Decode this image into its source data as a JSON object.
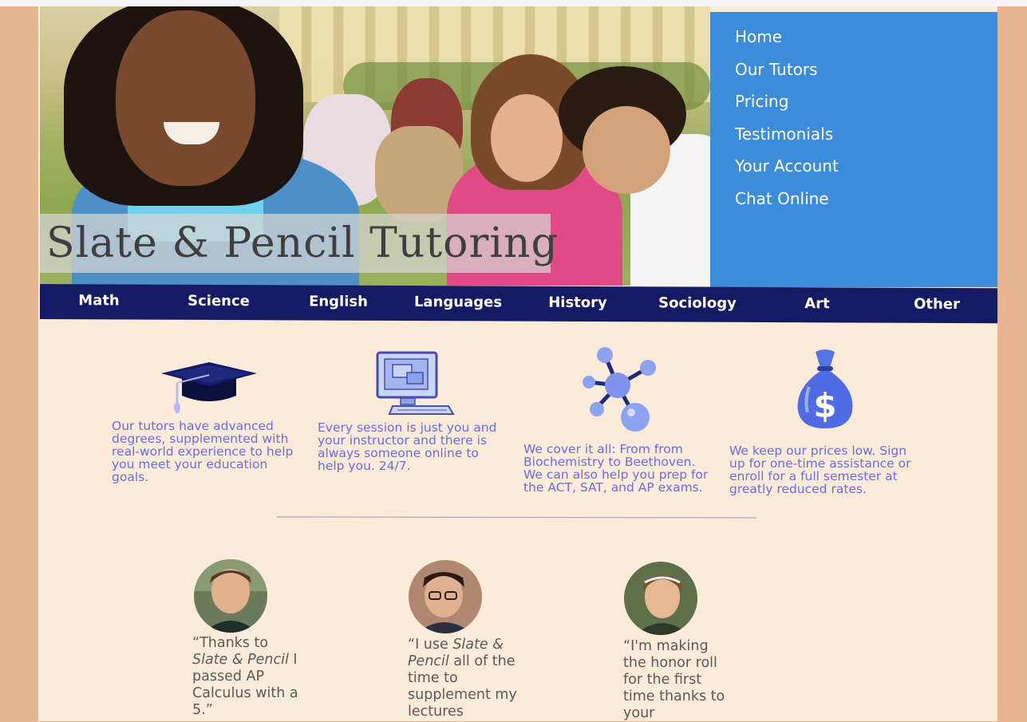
{
  "site": {
    "title": "Slate & Pencil Tutoring"
  },
  "nav": {
    "items": [
      "Home",
      "Our Tutors",
      "Pricing",
      "Testimonials",
      "Your Account",
      "Chat Online"
    ]
  },
  "subjects": {
    "items": [
      "Math",
      "Science",
      "English",
      "Languages",
      "History",
      "Sociology",
      "Art",
      "Other"
    ]
  },
  "features": [
    {
      "icon": "graduation-cap-icon",
      "text": "Our tutors have advanced degrees, supplemented with real-world experience to help you meet your education goals."
    },
    {
      "icon": "computer-icon",
      "text": "Every session is just you and your instructor and there is always someone online to help you. 24/7."
    },
    {
      "icon": "molecule-icon",
      "text": "We cover it all: From from Biochemistry to Beethoven. We can also help you prep for the ACT, SAT, and AP exams."
    },
    {
      "icon": "money-bag-icon",
      "text": "We keep our prices low. Sign up for one-time assistance or enroll for a full semester at greatly reduced rates."
    }
  ],
  "testimonials": [
    {
      "open": "“Thanks to ",
      "em": "Slate & Pencil",
      "close": " I passed AP Calculus with a 5.”"
    },
    {
      "open": "“I use ",
      "em": "Slate & Pencil",
      "close": " all of the time to supplement my lectures"
    },
    {
      "open": "“I'm making the honor roll for the first time thanks to your",
      "em": "",
      "close": ""
    }
  ]
}
